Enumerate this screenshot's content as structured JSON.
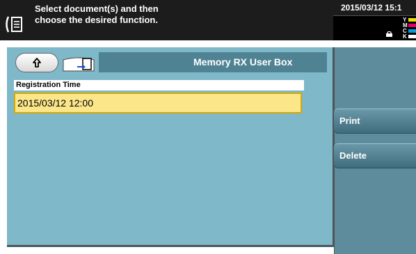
{
  "header": {
    "message_line1": "Select document(s) and then",
    "message_line2": "choose the desired function.",
    "datetime": "2015/03/12 15:1"
  },
  "toner": {
    "labels": [
      "Y",
      "M",
      "C",
      "K"
    ],
    "colors": [
      "#f0e000",
      "#e0006a",
      "#00a0e0",
      "#ffffff"
    ]
  },
  "box": {
    "title": "Memory RX User Box"
  },
  "list": {
    "column_header": "Registration Time",
    "rows": [
      {
        "time": "2015/03/12 12:00"
      }
    ]
  },
  "actions": {
    "print_label": "Print",
    "delete_label": "Delete"
  },
  "colors": {
    "panel": "#7fb8c9",
    "selection": "#fbe68a",
    "header_bg": "#1c1c1c"
  }
}
